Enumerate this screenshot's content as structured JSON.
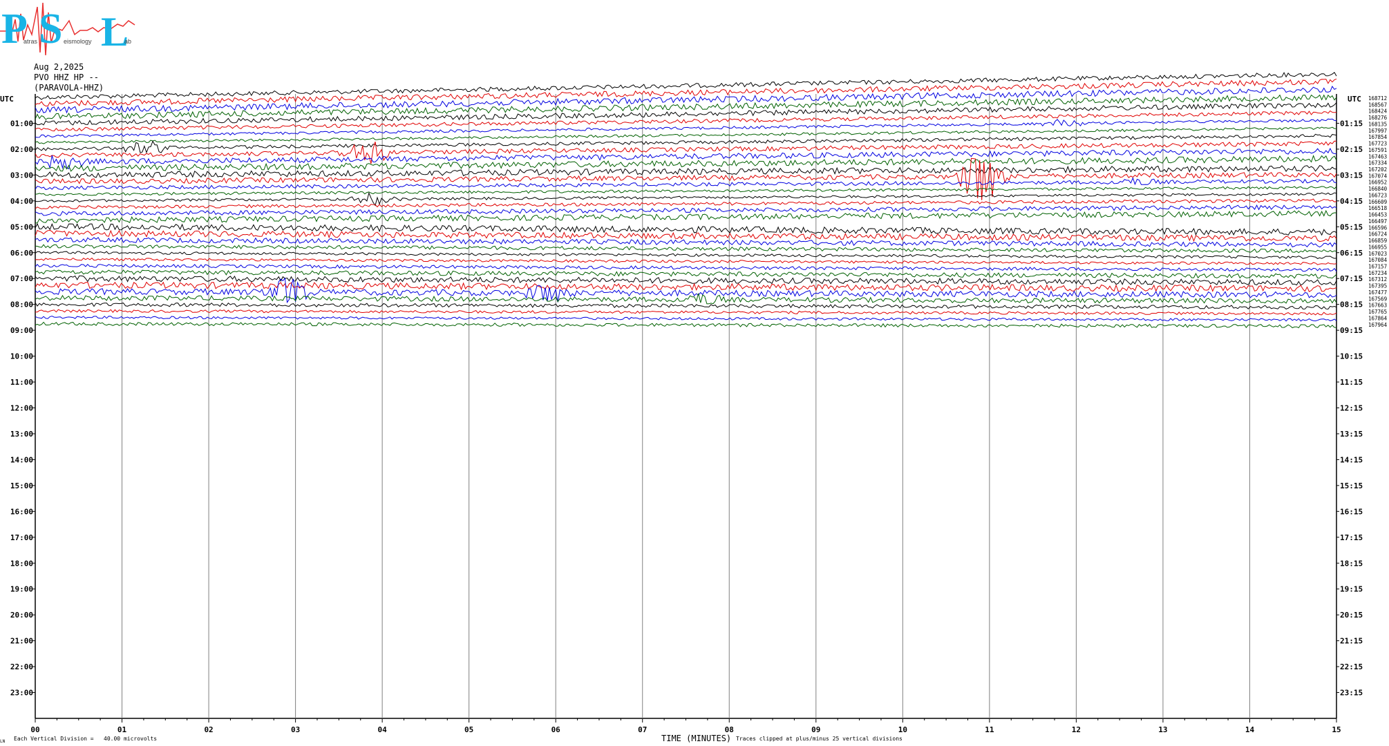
{
  "header": {
    "date": "Aug 2,2025",
    "station": "PVO HHZ HP --",
    "location": "(PARAVOLA-HHZ)"
  },
  "logo": {
    "big_letters": [
      "P",
      "S",
      "L"
    ],
    "small_text": [
      "atras",
      "eismology",
      "ab"
    ]
  },
  "footer": {
    "division_text": "Each Vertical Division =   40.00 microvolts",
    "clipped_text": "Traces clipped at plus/minus 25 vertical divisions",
    "corner_mark": "LN"
  },
  "colors": {
    "trace_cycle": [
      "#000000",
      "#e00000",
      "#0000e0",
      "#006000"
    ],
    "logo_letters": "#19b4e6",
    "logo_trace": "#e83030",
    "grid": "#808080"
  },
  "chart_data": {
    "type": "line",
    "title": "",
    "xlabel": "TIME (MINUTES)",
    "ylabel": "",
    "xlim": [
      0,
      15
    ],
    "x_ticks": [
      "00",
      "01",
      "02",
      "03",
      "04",
      "05",
      "06",
      "07",
      "08",
      "09",
      "10",
      "11",
      "12",
      "13",
      "14",
      "15"
    ],
    "left_axis_title": "UTC",
    "right_axis_title": "UTC",
    "left_labels": [
      "01:00",
      "02:00",
      "03:00",
      "04:00",
      "05:00",
      "06:00",
      "07:00",
      "08:00",
      "09:00",
      "10:00",
      "11:00",
      "12:00",
      "13:00",
      "14:00",
      "15:00",
      "16:00",
      "17:00",
      "18:00",
      "19:00",
      "20:00",
      "21:00",
      "22:00",
      "23:00"
    ],
    "right_labels": [
      "01:15",
      "02:15",
      "03:15",
      "04:15",
      "05:15",
      "06:15",
      "07:15",
      "08:15",
      "09:15",
      "10:15",
      "11:15",
      "12:15",
      "13:15",
      "14:15",
      "15:15",
      "16:15",
      "17:15",
      "18:15",
      "19:15",
      "20:15",
      "21:15",
      "22:15",
      "23:15"
    ],
    "trace_values": [
      "168712",
      "168567",
      "168424",
      "168276",
      "168135",
      "167997",
      "167854",
      "167723",
      "167591",
      "167463",
      "167334",
      "167202",
      "167074",
      "166952",
      "166840",
      "166723",
      "166609",
      "166518",
      "166453",
      "166497",
      "166596",
      "166724",
      "166859",
      "166955",
      "167023",
      "167084",
      "167157",
      "167234",
      "167312",
      "167395",
      "167477",
      "167569",
      "167663",
      "167765",
      "167864",
      "167964"
    ],
    "traces_per_hour": 4,
    "trace_count": 36,
    "events": [
      {
        "trace": 8,
        "minute": 1.3,
        "amplitude": 2.8
      },
      {
        "trace": 9,
        "minute": 3.8,
        "amplitude": 3.2
      },
      {
        "trace": 10,
        "minute": 0.3,
        "amplitude": 1.6
      },
      {
        "trace": 13,
        "minute": 10.9,
        "amplitude": 6.0
      },
      {
        "trace": 14,
        "minute": 12.7,
        "amplitude": 1.2
      },
      {
        "trace": 16,
        "minute": 3.9,
        "amplitude": 2.4
      },
      {
        "trace": 30,
        "minute": 2.9,
        "amplitude": 2.6
      },
      {
        "trace": 30,
        "minute": 5.9,
        "amplitude": 1.8
      },
      {
        "trace": 31,
        "minute": 7.7,
        "amplitude": 1.4
      },
      {
        "trace": 6,
        "minute": 11.8,
        "amplitude": 1.5
      }
    ]
  }
}
